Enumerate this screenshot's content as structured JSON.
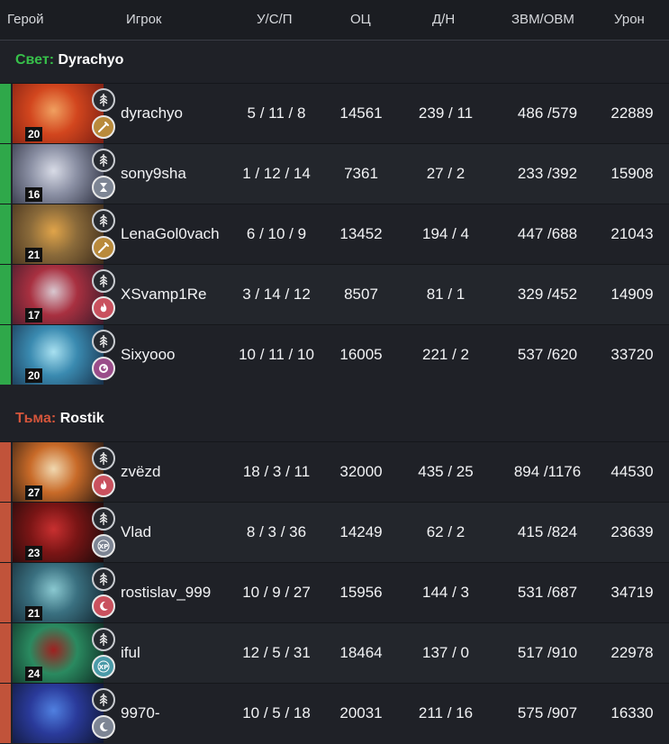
{
  "columns": {
    "hero": "Герой",
    "player": "Игрок",
    "kda": "У/С/П",
    "networth": "ОЦ",
    "lh_dn": "Д/Н",
    "gpm_xpm": "ЗВМ/ОВМ",
    "damage": "Урон"
  },
  "teams": {
    "light": {
      "side": "Свет:",
      "captain": "Dyrachyo",
      "color": "#37c04a",
      "stripe": "#2fa84a"
    },
    "dark": {
      "side": "Тьма:",
      "captain": "Rostik",
      "color": "#d4553b",
      "stripe": "#c1533a"
    }
  },
  "light_rows": [
    {
      "level": "20",
      "player": "dyrachyo",
      "kda": "5 / 11 / 8",
      "nw": "14561",
      "lh": "239 / 11",
      "gpm": "486 /579",
      "dmg": "22889",
      "hero_colors": [
        "#7a1d12",
        "#d2461e",
        "#f0a060"
      ],
      "role_icon": "carry-icon",
      "role_color": "#b98a3b"
    },
    {
      "level": "16",
      "player": "sony9sha",
      "kda": "1 / 12 / 14",
      "nw": "7361",
      "lh": "27 / 2",
      "gpm": "233 /392",
      "dmg": "15908",
      "hero_colors": [
        "#2a2d3d",
        "#8a8fa3",
        "#d8dbe6"
      ],
      "role_icon": "hourglass-icon",
      "role_color": "#7d8594"
    },
    {
      "level": "21",
      "player": "LenaGol0vach",
      "kda": "6 / 10 / 9",
      "nw": "13452",
      "lh": "194 / 4",
      "gpm": "447 /688",
      "dmg": "21043",
      "hero_colors": [
        "#3b2a1a",
        "#8a6a3a",
        "#e0a44a"
      ],
      "role_icon": "carry-icon",
      "role_color": "#b98a3b"
    },
    {
      "level": "17",
      "player": "XSvamp1Re",
      "kda": "3 / 14 / 12",
      "nw": "8507",
      "lh": "81 / 1",
      "gpm": "329 /452",
      "dmg": "14909",
      "hero_colors": [
        "#3b1a2a",
        "#a83040",
        "#d8c8d0"
      ],
      "role_icon": "fire-icon",
      "role_color": "#c9515e"
    },
    {
      "level": "20",
      "player": "Sixyooo",
      "kda": "10 / 11 / 10",
      "nw": "16005",
      "lh": "221 / 2",
      "gpm": "537 /620",
      "dmg": "33720",
      "hero_colors": [
        "#17304a",
        "#3a8ab0",
        "#a8e0f0"
      ],
      "role_icon": "swirl-icon",
      "role_color": "#9a4d8a"
    }
  ],
  "dark_rows": [
    {
      "level": "27",
      "player": "zvëzd",
      "kda": "18 / 3 / 11",
      "nw": "32000",
      "lh": "435 / 25",
      "gpm": "894 /1176",
      "dmg": "44530",
      "hero_colors": [
        "#2a1a12",
        "#c86a28",
        "#f0d8b0"
      ],
      "role_icon": "fire-icon",
      "role_color": "#c9515e"
    },
    {
      "level": "23",
      "player": "Vlad",
      "kda": "8 / 3 / 36",
      "nw": "14249",
      "lh": "62 / 2",
      "gpm": "415 /824",
      "dmg": "23639",
      "hero_colors": [
        "#1a0a0a",
        "#7a1515",
        "#c83030"
      ],
      "role_icon": "xp-icon",
      "role_color": "#7d8594"
    },
    {
      "level": "21",
      "player": "rostislav_999",
      "kda": "10 / 9 / 27",
      "nw": "15956",
      "lh": "144 / 3",
      "gpm": "531 /687",
      "dmg": "34719",
      "hero_colors": [
        "#12242e",
        "#3a7080",
        "#8ac8d0"
      ],
      "role_icon": "moon-icon",
      "role_color": "#c9515e"
    },
    {
      "level": "24",
      "player": "iful",
      "kda": "12 / 5 / 31",
      "nw": "18464",
      "lh": "137 / 0",
      "gpm": "517 /910",
      "dmg": "22978",
      "hero_colors": [
        "#0e2a22",
        "#2a8a60",
        "#a02020"
      ],
      "role_icon": "xp-icon",
      "role_color": "#4a9aa8"
    },
    {
      "level": "",
      "player": "9970-",
      "kda": "10 / 5 / 18",
      "nw": "20031",
      "lh": "211 / 16",
      "gpm": "575 /907",
      "dmg": "16330",
      "hero_colors": [
        "#0e1530",
        "#2a3a9a",
        "#5080e0"
      ],
      "role_icon": "moon-icon",
      "role_color": "#7d8594"
    }
  ]
}
